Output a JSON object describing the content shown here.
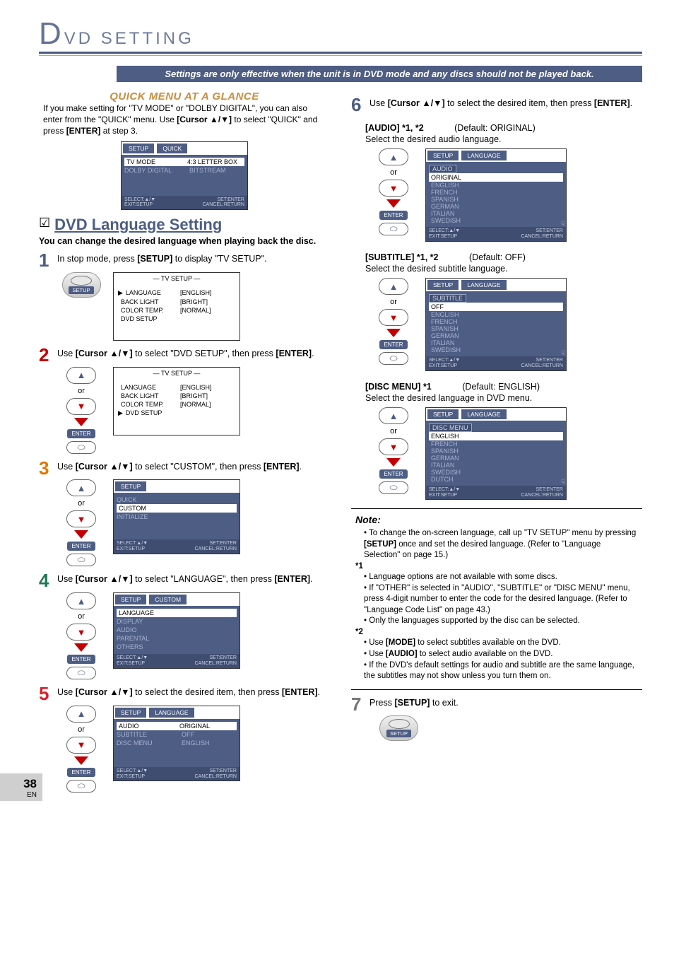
{
  "header": {
    "big": "D",
    "rest": "VD SETTING"
  },
  "banner": "Settings are only effective when the unit is in DVD mode and any discs should not be played back.",
  "glance": {
    "title": "QUICK MENU AT A GLANCE",
    "text_a": "If you make setting for \"TV MODE\" or \"DOLBY DIGITAL\", you can also enter from the \"QUICK\" menu. Use ",
    "cursor": "[Cursor ▲/▼]",
    "text_b": " to select \"QUICK\" and press ",
    "enter": "[ENTER]",
    "text_c": " at step 3."
  },
  "osd_quick": {
    "tab1": "SETUP",
    "tab2": "QUICK",
    "rows": [
      {
        "l": "TV MODE",
        "r": "4:3 LETTER BOX",
        "sel": true
      },
      {
        "l": "DOLBY DIGITAL",
        "r": "BITSTREAM",
        "sel": false
      }
    ],
    "foot_l1": "SELECT:▲/▼",
    "foot_l2": "EXIT:SETUP",
    "foot_r1": "SET:ENTER",
    "foot_r2": "CANCEL:RETURN"
  },
  "section": {
    "title": "DVD Language Setting",
    "sub": "You can change the desired language when playing back the disc."
  },
  "steps": {
    "s1": {
      "a": "In stop mode, press ",
      "b": "[SETUP]",
      "c": " to display \"TV SETUP\"."
    },
    "s2": {
      "a": "Use ",
      "b": "[Cursor ▲/▼]",
      "c": " to select \"DVD SETUP\", then press ",
      "d": "[ENTER]",
      "e": "."
    },
    "s3": {
      "a": "Use ",
      "b": "[Cursor ▲/▼]",
      "c": " to select \"CUSTOM\", then press ",
      "d": "[ENTER]",
      "e": "."
    },
    "s4": {
      "a": "Use ",
      "b": "[Cursor ▲/▼]",
      "c": " to select \"LANGUAGE\", then press ",
      "d": "[ENTER]",
      "e": "."
    },
    "s5": {
      "a": "Use ",
      "b": "[Cursor ▲/▼]",
      "c": " to select the desired item, then press ",
      "d": "[ENTER]",
      "e": "."
    },
    "s6": {
      "a": "Use ",
      "b": "[Cursor ▲/▼]",
      "c": " to select the desired item, then press ",
      "d": "[ENTER]",
      "e": "."
    },
    "s7": {
      "a": "Press ",
      "b": "[SETUP]",
      "c": " to exit."
    }
  },
  "osd_tv1": {
    "title": "— TV SETUP —",
    "rows": [
      {
        "l": "LANGUAGE",
        "r": "[ENGLISH]",
        "mark": "▶"
      },
      {
        "l": "BACK LIGHT",
        "r": "[BRIGHT]"
      },
      {
        "l": "COLOR TEMP.",
        "r": "[NORMAL]"
      },
      {
        "l": "DVD SETUP",
        "r": ""
      }
    ]
  },
  "osd_tv2": {
    "title": "— TV SETUP —",
    "rows": [
      {
        "l": "LANGUAGE",
        "r": "[ENGLISH]"
      },
      {
        "l": "BACK LIGHT",
        "r": "[BRIGHT]"
      },
      {
        "l": "COLOR TEMP.",
        "r": "[NORMAL]"
      },
      {
        "l": "DVD SETUP",
        "r": "",
        "mark": "▶"
      }
    ]
  },
  "osd_custom": {
    "tab1": "SETUP",
    "items": [
      "QUICK",
      "CUSTOM",
      "INITIALIZE"
    ],
    "sel_index": 1,
    "foot_l1": "SELECT:▲/▼",
    "foot_l2": "EXIT:SETUP",
    "foot_r1": "SET:ENTER",
    "foot_r2": "CANCEL:RETURN"
  },
  "osd_lang_menu": {
    "tab1": "SETUP",
    "tab2": "CUSTOM",
    "items": [
      "LANGUAGE",
      "DISPLAY",
      "AUDIO",
      "PARENTAL",
      "OTHERS"
    ],
    "sel_index": 0,
    "foot_l1": "SELECT:▲/▼",
    "foot_l2": "EXIT:SETUP",
    "foot_r1": "SET:ENTER",
    "foot_r2": "CANCEL:RETURN"
  },
  "osd_lang_vals": {
    "tab1": "SETUP",
    "tab2": "LANGUAGE",
    "rows": [
      {
        "l": "AUDIO",
        "r": "ORIGINAL",
        "sel": true
      },
      {
        "l": "SUBTITLE",
        "r": "OFF"
      },
      {
        "l": "DISC MENU",
        "r": "ENGLISH"
      }
    ],
    "foot_l1": "SELECT:▲/▼",
    "foot_l2": "EXIT:SETUP",
    "foot_r1": "SET:ENTER",
    "foot_r2": "CANCEL:RETURN"
  },
  "audio_block": {
    "lbl": "[AUDIO] *1, *2",
    "def": "(Default: ORIGINAL)",
    "desc": "Select the desired audio language.",
    "osd": {
      "tab1": "SETUP",
      "tab2": "LANGUAGE",
      "group": "AUDIO",
      "items": [
        "ORIGINAL",
        "ENGLISH",
        "FRENCH",
        "SPANISH",
        "GERMAN",
        "ITALIAN",
        "SWEDISH"
      ],
      "sel_index": 0
    }
  },
  "subtitle_block": {
    "lbl": "[SUBTITLE] *1, *2",
    "def": "(Default: OFF)",
    "desc": "Select the desired subtitle language.",
    "osd": {
      "tab1": "SETUP",
      "tab2": "LANGUAGE",
      "group": "SUBTITLE",
      "items": [
        "OFF",
        "ENGLISH",
        "FRENCH",
        "SPANISH",
        "GERMAN",
        "ITALIAN",
        "SWEDISH"
      ],
      "sel_index": 0
    }
  },
  "discmenu_block": {
    "lbl": "[DISC MENU] *1",
    "def": "(Default: ENGLISH)",
    "desc": "Select the desired language in DVD menu.",
    "osd": {
      "tab1": "SETUP",
      "tab2": "LANGUAGE",
      "group": "DISC MENU",
      "items": [
        "ENGLISH",
        "FRENCH",
        "SPANISH",
        "GERMAN",
        "ITALIAN",
        "SWEDISH",
        "DUTCH"
      ],
      "sel_index": 0
    }
  },
  "note": {
    "title": "Note:",
    "top": {
      "a": "To change the on-screen language, call up \"TV SETUP\" menu by pressing ",
      "b": "[SETUP]",
      "c": " once and set the desired language. (Refer to \"Language Selection\" on page 15.)"
    },
    "star1_label": "*1",
    "star1_items": [
      "Language options are not available with some discs.",
      "If \"OTHER\" is selected in \"AUDIO\", \"SUBTITLE\" or \"DISC MENU\" menu, press 4-digit number to enter the code for the desired language. (Refer to \"Language Code List\" on page 43.)",
      "Only the languages supported by the disc can be selected."
    ],
    "star2_label": "*2",
    "star2_mode": {
      "a": "Use ",
      "b": "[MODE]",
      "c": " to select subtitles available on the DVD."
    },
    "star2_audio": {
      "a": "Use ",
      "b": "[AUDIO]",
      "c": " to select audio available on the DVD."
    },
    "star2_last": "If the DVD's default settings for audio and subtitle are the same language, the subtitles may not show unless you turn them on."
  },
  "labels": {
    "or": "or",
    "enter_pill": "ENTER",
    "setup_pill": "SETUP"
  },
  "foot": {
    "l1": "SELECT:▲/▼",
    "l2": "EXIT:SETUP",
    "r1": "SET:ENTER",
    "r2": "CANCEL:RETURN"
  },
  "page": {
    "num": "38",
    "en": "EN"
  }
}
